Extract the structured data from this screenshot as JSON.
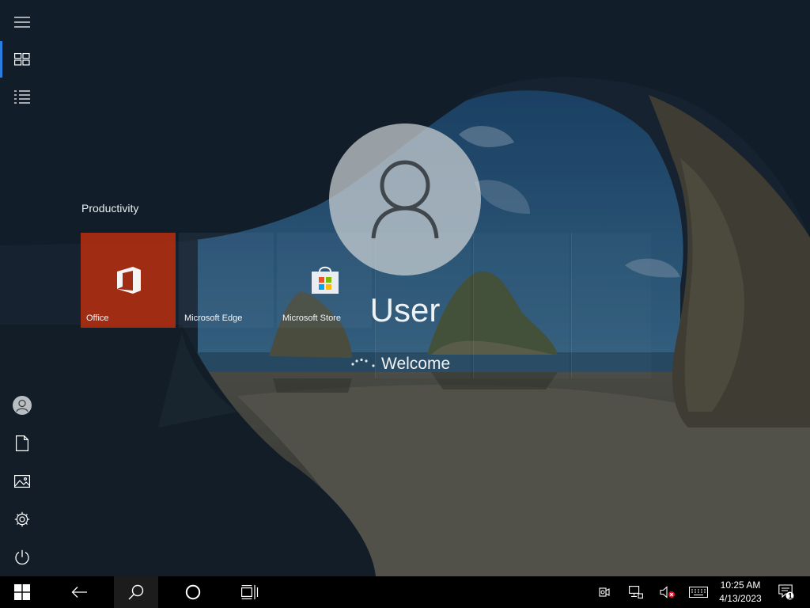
{
  "start": {
    "group_label": "Productivity",
    "tiles": [
      {
        "label": "Office",
        "icon": "office-icon",
        "color": "#be300e"
      },
      {
        "label": "Microsoft Edge",
        "icon": "edge-icon"
      },
      {
        "label": "Microsoft Store",
        "icon": "store-icon"
      }
    ]
  },
  "rail": {
    "items": [
      "menu-icon",
      "tiles-icon",
      "all-apps-icon",
      "user-icon",
      "documents-icon",
      "pictures-icon",
      "settings-icon",
      "power-icon"
    ],
    "accent": "#2a7de1"
  },
  "welcome": {
    "user_name": "User",
    "message": "Welcome"
  },
  "taskbar": {
    "buttons": [
      "windows-icon",
      "back-icon",
      "search-icon",
      "cortana-icon",
      "task-view-icon"
    ],
    "tray": [
      "camera-icon",
      "network-icon",
      "volume-muted-icon",
      "keyboard-icon",
      "notifications-icon"
    ],
    "time": "10:25 AM",
    "date": "4/13/2023",
    "notification_count": "1"
  }
}
